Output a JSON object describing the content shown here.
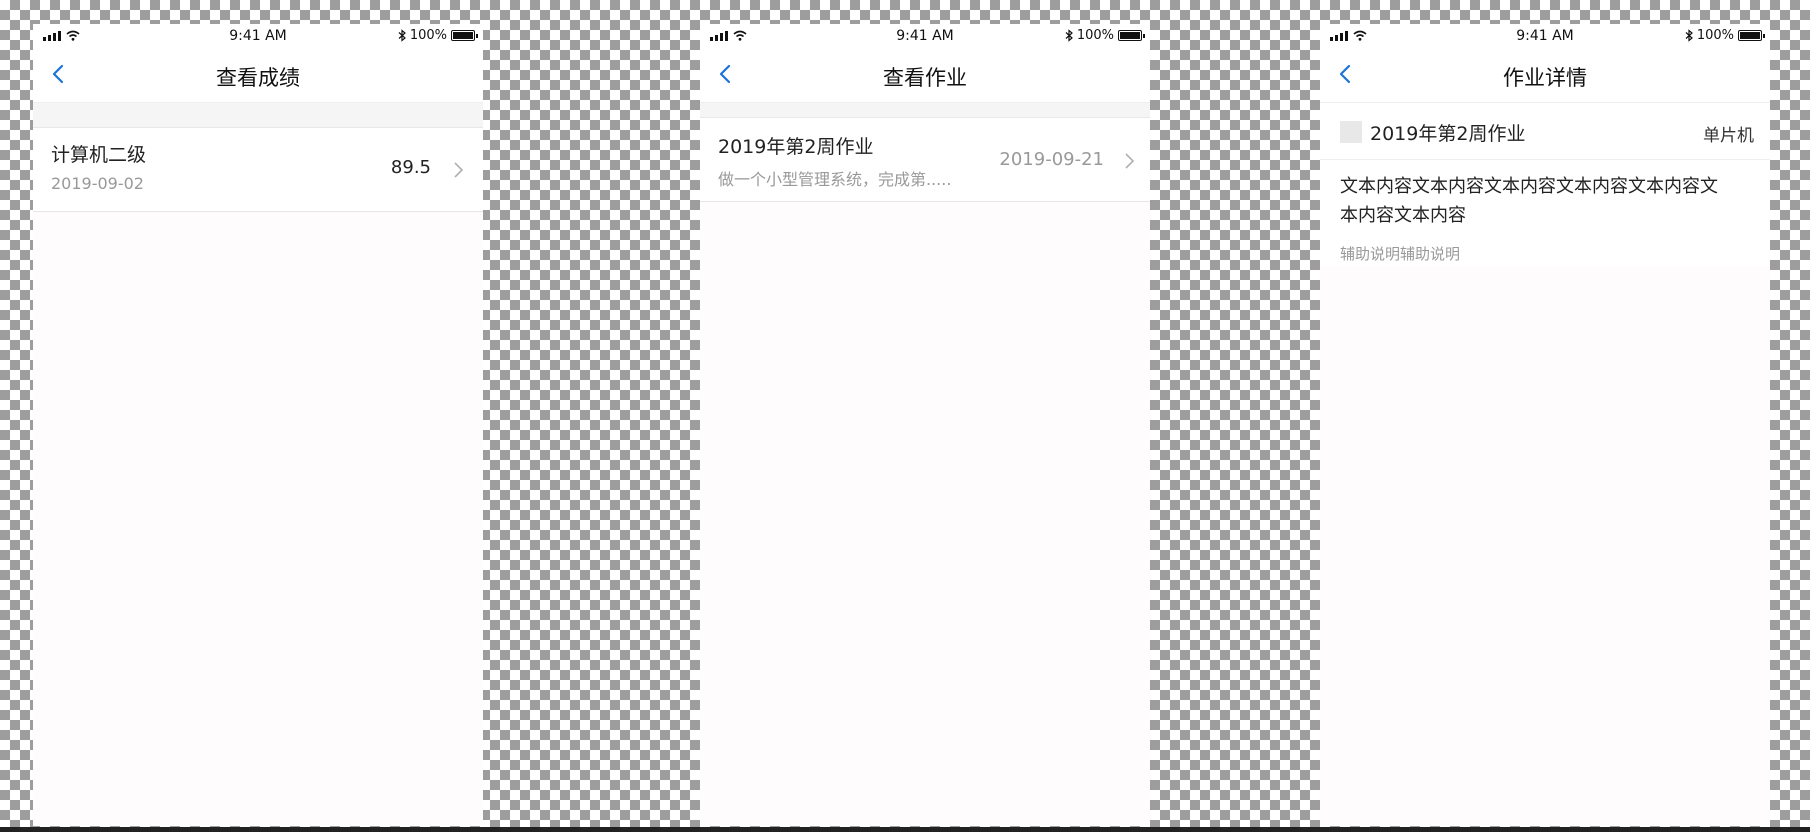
{
  "screens": [
    {
      "status": {
        "time": "9:41 AM",
        "battery": "100%"
      },
      "title": "查看成绩",
      "item": {
        "title": "计算机二级",
        "date": "2019-09-02",
        "score": "89.5"
      }
    },
    {
      "status": {
        "time": "9:41 AM",
        "battery": "100%"
      },
      "title": "查看作业",
      "item": {
        "title": "2019年第2周作业",
        "summary": "做一个小型管理系统，完成第.....",
        "date": "2019-09-21"
      }
    },
    {
      "status": {
        "time": "9:41 AM",
        "battery": "100%"
      },
      "title": "作业详情",
      "detail": {
        "title": "2019年第2周作业",
        "course": "单片机",
        "content": "文本内容文本内容文本内容文本内容文本内容文本内容文本内容",
        "note": "辅助说明辅助说明"
      }
    }
  ],
  "icons": {
    "back": "chevron-left-icon",
    "arrow": "chevron-right-icon"
  },
  "colors": {
    "accent": "#1a73d9",
    "muted": "#999999",
    "divider": "#e6e6e6"
  }
}
